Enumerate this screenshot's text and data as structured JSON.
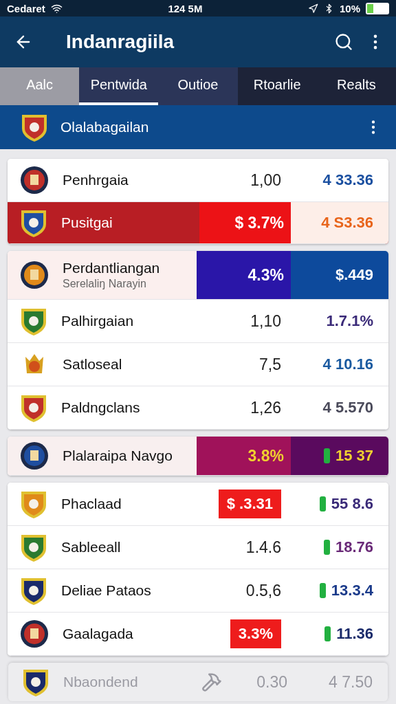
{
  "status_bar": {
    "carrier": "Cedaret",
    "time": "124 5M",
    "battery": "10%"
  },
  "app_bar": {
    "title": "Indanragiila"
  },
  "tabs": [
    {
      "label": "Aalc",
      "selected": false
    },
    {
      "label": "Pentwida",
      "selected": true
    },
    {
      "label": "Outioe",
      "selected": false
    },
    {
      "label": "Rtoarlie",
      "selected": false
    },
    {
      "label": "Realts",
      "selected": false
    }
  ],
  "section": {
    "title": "Olalabagailan"
  },
  "cards": [
    {
      "rows": [
        {
          "kind": "plain",
          "name": "Penhrgaia",
          "value": "1,00",
          "price": "4 33.36",
          "color": "#1a4fa0",
          "price_icon": false
        },
        {
          "kind": "band",
          "name": "Pusitgai",
          "value": "$ 3.7%",
          "price": "4 S3.36",
          "color": "#e8641a",
          "price_icon": false
        }
      ]
    },
    {
      "rows": [
        {
          "kind": "band2",
          "name": "Perdantliangan",
          "subtitle": "Serelaliŋ Narayin",
          "value": "4.3%",
          "price": "$.449",
          "color": "#ffffff",
          "price_icon": false
        },
        {
          "kind": "plain",
          "name": "Palhirgaian",
          "value": "1,10",
          "price": "1.7.1%",
          "color": "#3a2a78",
          "price_icon": false
        },
        {
          "kind": "plain",
          "name": "Satloseal",
          "value": "7,5",
          "price": "4 10.16",
          "color": "#1a5aa0",
          "price_icon": false
        },
        {
          "kind": "plain",
          "name": "Paldngclans",
          "value": "1,26",
          "price": "4 5.570",
          "color": "#4a4a5a",
          "price_icon": false
        }
      ]
    },
    {
      "rows": [
        {
          "kind": "band3",
          "name": "Plalaraipa Navgo",
          "value": "3.8%",
          "price": "15 37",
          "color": "#f0d030",
          "price_icon": true
        }
      ]
    },
    {
      "rows": [
        {
          "kind": "badge",
          "name": "Phaclaad",
          "value": "$ .3.31",
          "price": "55 8.6",
          "color": "#3a2a78",
          "price_icon": true
        },
        {
          "kind": "plain",
          "name": "Sableeall",
          "value": "1.4.6",
          "price": "18.76",
          "color": "#6a2a78",
          "price_icon": true
        },
        {
          "kind": "plain",
          "name": "Deliae Pataos",
          "value": "0.5,6",
          "price": "13.3.4",
          "color": "#1a3a8a",
          "price_icon": true
        },
        {
          "kind": "badge",
          "name": "Gaalagada",
          "value": "3.3%",
          "price": "11.36",
          "color": "#1a2a6a",
          "price_icon": true
        }
      ]
    }
  ],
  "footer_row": {
    "name": "Nbaondend",
    "value": "0.30",
    "price": "4 7.50",
    "disabled": true
  }
}
